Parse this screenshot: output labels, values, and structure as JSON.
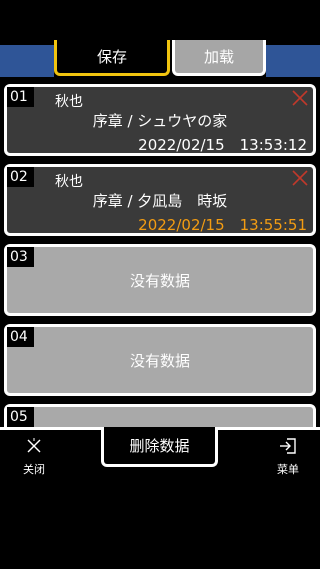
{
  "tabs": {
    "save": "保存",
    "load": "加载"
  },
  "slots": [
    {
      "num": "01",
      "name": "秋也",
      "chapter": "序章 / シュウヤの家",
      "datetime": "2022/02/15　13:53:12",
      "latest": false
    },
    {
      "num": "02",
      "name": "秋也",
      "chapter": "序章 / 夕凪島　時坂",
      "datetime": "2022/02/15　13:55:51",
      "latest": true
    },
    {
      "num": "03",
      "empty_text": "没有数据"
    },
    {
      "num": "04",
      "empty_text": "没有数据"
    },
    {
      "num": "05"
    }
  ],
  "bottom": {
    "close_label": "关闭",
    "delete_label": "删除数据",
    "menu_label": "菜单"
  },
  "colors": {
    "accent_tab": "#f1c40f",
    "latest_time": "#f39c12",
    "delete_x": "#c0392b",
    "band": "#2f5597"
  },
  "icons": {
    "delete": "x-icon",
    "close": "close-icon",
    "menu": "exit-menu-icon"
  }
}
